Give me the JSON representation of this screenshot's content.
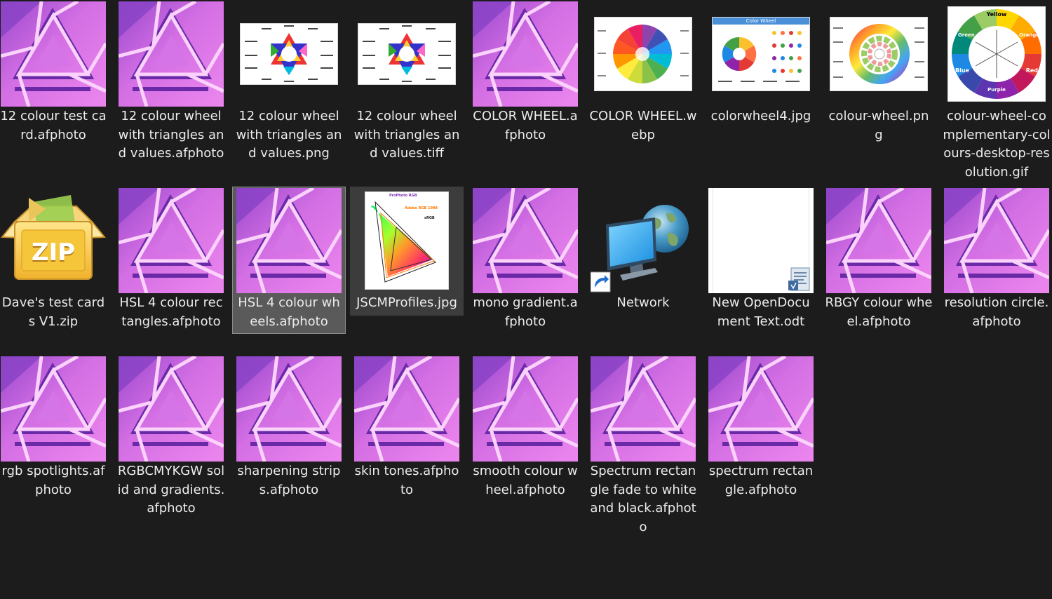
{
  "files": [
    {
      "id": "f1",
      "type": "afphoto",
      "label": "12 colour test card.afphoto"
    },
    {
      "id": "f2",
      "type": "afphoto",
      "label": "12 colour wheel with triangles and values.afphoto"
    },
    {
      "id": "f3",
      "type": "png-values",
      "label": "12 colour wheel with triangles and values.png"
    },
    {
      "id": "f4",
      "type": "png-values",
      "label": "12 colour wheel with triangles and values.tiff"
    },
    {
      "id": "f5",
      "type": "afphoto",
      "label": "COLOR WHEEL.afphoto"
    },
    {
      "id": "f6",
      "type": "wheel-pie",
      "label": "COLOR WHEEL.webp"
    },
    {
      "id": "f7",
      "type": "wheel-doc",
      "label": "colorwheel4.jpg"
    },
    {
      "id": "f8",
      "type": "wheel-ring",
      "label": "colour-wheel.png"
    },
    {
      "id": "f9",
      "type": "wheel-big",
      "label": "colour-wheel-complementary-colours-desktop-resolution.gif"
    },
    {
      "id": "f10",
      "type": "zip",
      "label": "Dave's test cards V1.zip"
    },
    {
      "id": "f11",
      "type": "afphoto",
      "label": "HSL 4 colour rectangles.afphoto"
    },
    {
      "id": "f12",
      "type": "afphoto",
      "label": "HSL 4 colour wheels.afphoto",
      "state": "selected"
    },
    {
      "id": "f13",
      "type": "gamut",
      "label": "JSCMProfiles.jpg",
      "state": "hover"
    },
    {
      "id": "f14",
      "type": "afphoto",
      "label": "mono gradient.afphoto"
    },
    {
      "id": "f15",
      "type": "network",
      "label": "Network"
    },
    {
      "id": "f16",
      "type": "odt",
      "label": "New OpenDocument Text.odt"
    },
    {
      "id": "f17",
      "type": "afphoto",
      "label": "RBGY colour wheel.afphoto"
    },
    {
      "id": "f18",
      "type": "afphoto",
      "label": "resolution circle.afphoto"
    },
    {
      "id": "f19",
      "type": "afphoto",
      "label": "rgb spotlights.afphoto"
    },
    {
      "id": "f20",
      "type": "afphoto",
      "label": "RGBCMYKGW solid and gradients.afphoto"
    },
    {
      "id": "f21",
      "type": "afphoto",
      "label": "sharpening strips.afphoto"
    },
    {
      "id": "f22",
      "type": "afphoto",
      "label": "skin tones.afphoto"
    },
    {
      "id": "f23",
      "type": "afphoto",
      "label": "smooth colour wheel.afphoto"
    },
    {
      "id": "f24",
      "type": "afphoto",
      "label": "Spectrum rectangle fade to white and black.afphoto"
    },
    {
      "id": "f25",
      "type": "afphoto",
      "label": "spectrum rectangle.afphoto"
    }
  ],
  "thumb_text": {
    "wheel_doc_title": "Color Wheel",
    "wheel_big_top": "Yellow",
    "wheel_big_left": "Green",
    "wheel_big_right": "Orange",
    "wheel_big_blue": "Blue",
    "wheel_big_red": "Red",
    "wheel_big_bottom": "Purple",
    "zip_text": "ZIP",
    "gamut_title": "ProPhoto RGB",
    "gamut_adobe": "Adobe RGB 1998",
    "gamut_srgb": "sRGB"
  },
  "colors": {
    "background": "#1c1c1c",
    "text": "#ececec",
    "afphoto_light": "#e57be9",
    "afphoto_dark": "#8f43c8",
    "selected_bg": "#5a5a5a",
    "hover_bg": "#3c3c3c"
  }
}
